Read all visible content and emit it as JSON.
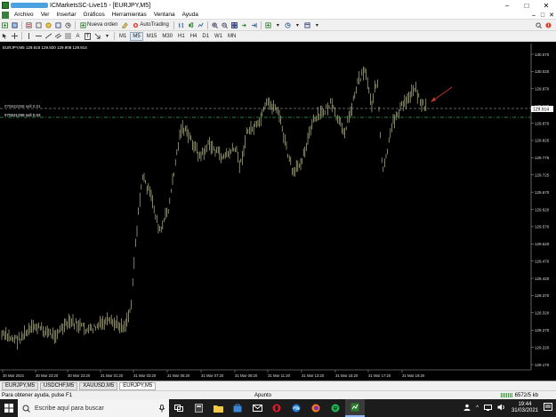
{
  "window": {
    "title": "ICMarketsSC-Live15 - [EURJPY,M5]",
    "min": "–",
    "max": "□",
    "close": "✕"
  },
  "menu": {
    "items": [
      "Archivo",
      "Ver",
      "Insertar",
      "Gráficos",
      "Herramientas",
      "Ventana",
      "Ayuda"
    ],
    "right": [
      "–",
      "□",
      "✕"
    ]
  },
  "toolbar": {
    "new_order": "Nueva orden",
    "autotrading": "AutoTrading",
    "timeframes": [
      "M1",
      "M5",
      "M15",
      "M30",
      "H1",
      "H4",
      "D1",
      "W1",
      "MN"
    ],
    "text_tool": "A",
    "label_tool": "T"
  },
  "chart": {
    "header": "EURJPY,M5  129.918 129.920 129.908 129.914",
    "order1": "#70632258 sell 0.01",
    "order2": "#70631299 sell 0.03",
    "current_price": "129.914",
    "colors": {
      "bars": "#d9d9a0",
      "order1_line": "#bdbdbd",
      "order2_line": "#22b14c",
      "arrow": "#c0392b"
    },
    "y_ticks": [
      "130.070",
      "130.020",
      "129.970",
      "129.920",
      "129.870",
      "129.825",
      "129.775",
      "129.725",
      "129.670",
      "129.620",
      "129.570",
      "129.520",
      "129.470",
      "129.420",
      "129.370",
      "129.320",
      "129.270",
      "129.220",
      "129.170"
    ],
    "x_ticks": [
      "30 Mar 2021",
      "30 Mar 23:20",
      "30 Mar 23:20",
      "31 Mar 01:20",
      "31 Mar 03:20",
      "31 Mar 05:20",
      "31 Mar 07:20",
      "31 Mar 09:20",
      "31 Mar 11:20",
      "31 Mar 13:20",
      "31 Mar 15:20",
      "31 Mar 17:20",
      "31 Mar 19:20"
    ]
  },
  "tabs": [
    "EURJPY,M5",
    "USDCHF,M5",
    "XAUUSD,M5",
    "EURJPY,M5"
  ],
  "status": {
    "help": "Para obtener ayuda, pulse F1",
    "mode": "Apunto",
    "traffic": "6572/5 kb"
  },
  "taskbar": {
    "search_placeholder": "Escribe aquí para buscar",
    "time": "19:44",
    "date": "31/03/2021"
  }
}
